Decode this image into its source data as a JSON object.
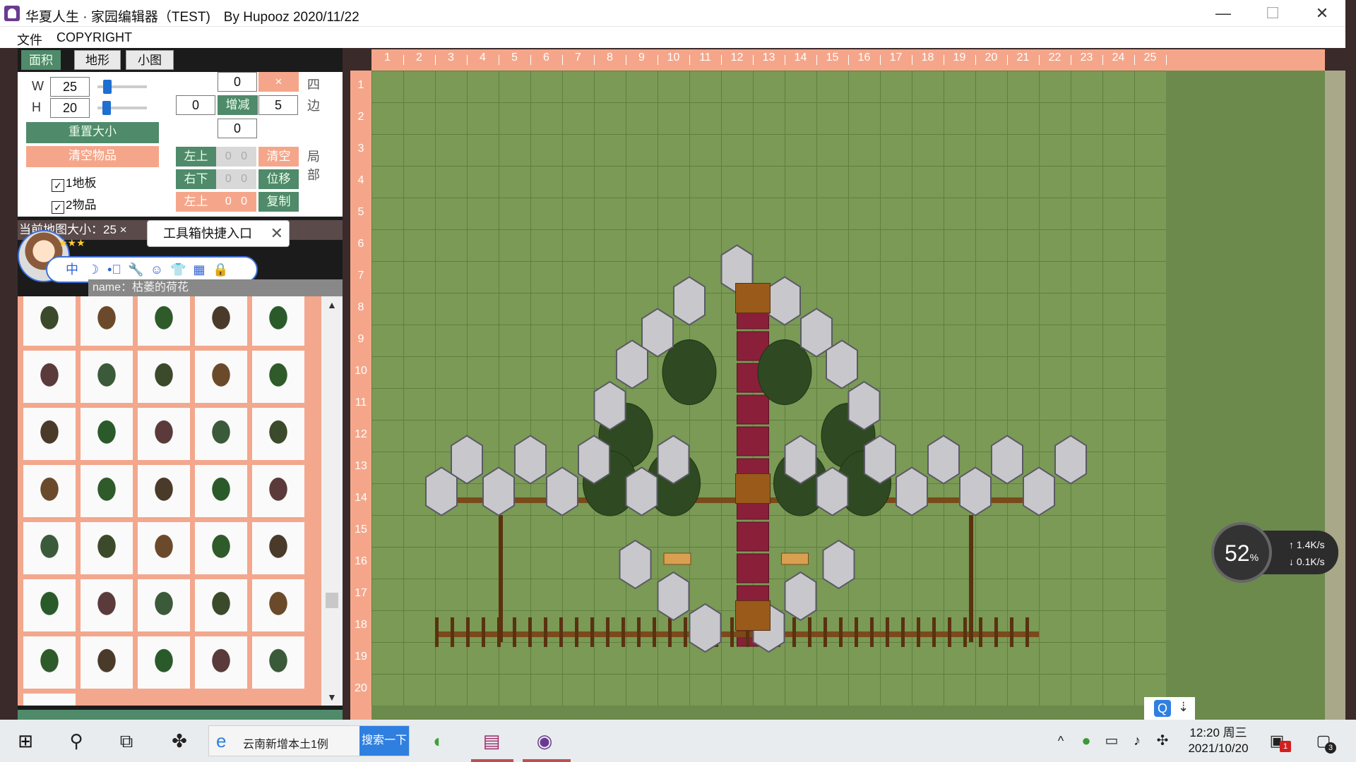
{
  "window": {
    "title": "华夏人生 · 家园编辑器（TEST)　By Hupooz  2020/11/22",
    "minimize_glyph": "—",
    "maximize_glyph": "☐",
    "close_glyph": "✕"
  },
  "menu": {
    "file": "文件",
    "copyright": "COPYRIGHT"
  },
  "tabs": [
    "面积",
    "地形",
    "小图"
  ],
  "size": {
    "w_label": "W",
    "w_value": "25",
    "h_label": "H",
    "h_value": "20",
    "w_slider_fraction": 0.12,
    "h_slider_fraction": 0.1,
    "reset_label": "重置大小",
    "clear_items_label": "清空物品",
    "check1_label": "1地板",
    "check1_checked": true,
    "check2_label": "2物品",
    "check2_checked": true
  },
  "edges": {
    "top": "0",
    "left": "0",
    "right": "5",
    "bottom": "0",
    "x_label": "×",
    "adjust_label": "增减",
    "side_label_1": "四",
    "side_label_2": "边"
  },
  "local": {
    "top_left_label": "左上",
    "bottom_right_label": "右下",
    "top_left_label_2": "左上",
    "clear_label": "清空",
    "move_label": "位移",
    "copy_label": "复制",
    "row1_a": "0",
    "row1_b": "0",
    "row2_a": "0",
    "row2_b": "0",
    "row3_a": "0",
    "row3_b": "0",
    "side_label_1": "局",
    "side_label_2": "部"
  },
  "status": {
    "map_size": "当前地图大小：25 ×"
  },
  "tooltip": {
    "text": "工具箱快捷入口",
    "close": "✕"
  },
  "toolbox": {
    "icons": [
      "中",
      "☽",
      "•ﾞ",
      "🔧",
      "☺",
      "👕",
      "▦",
      "🔒"
    ],
    "stars": "★★★"
  },
  "item_name": "name：枯萎的荷花",
  "ruler": {
    "cols": [
      "1",
      "2",
      "3",
      "4",
      "5",
      "6",
      "7",
      "8",
      "9",
      "10",
      "11",
      "12",
      "13",
      "14",
      "15",
      "16",
      "17",
      "18",
      "19",
      "20",
      "21",
      "22",
      "23",
      "24",
      "25"
    ],
    "rows": [
      "1",
      "2",
      "3",
      "4",
      "5",
      "6",
      "7",
      "8",
      "9",
      "10",
      "11",
      "12",
      "13",
      "14",
      "15",
      "16",
      "17",
      "18",
      "19",
      "20"
    ]
  },
  "network": {
    "percent": "52",
    "percent_unit": "%",
    "up": "↑ 1.4K/s",
    "down": "↓ 0.1K/s"
  },
  "quick": {
    "q": "Q",
    "arrow": "⇣"
  },
  "taskbar": {
    "search_text": "云南新增本土1例",
    "search_button": "搜索一下",
    "time": "12:20 周三",
    "date": "2021/10/20",
    "notification_count": "3",
    "mail_badge": "1"
  }
}
